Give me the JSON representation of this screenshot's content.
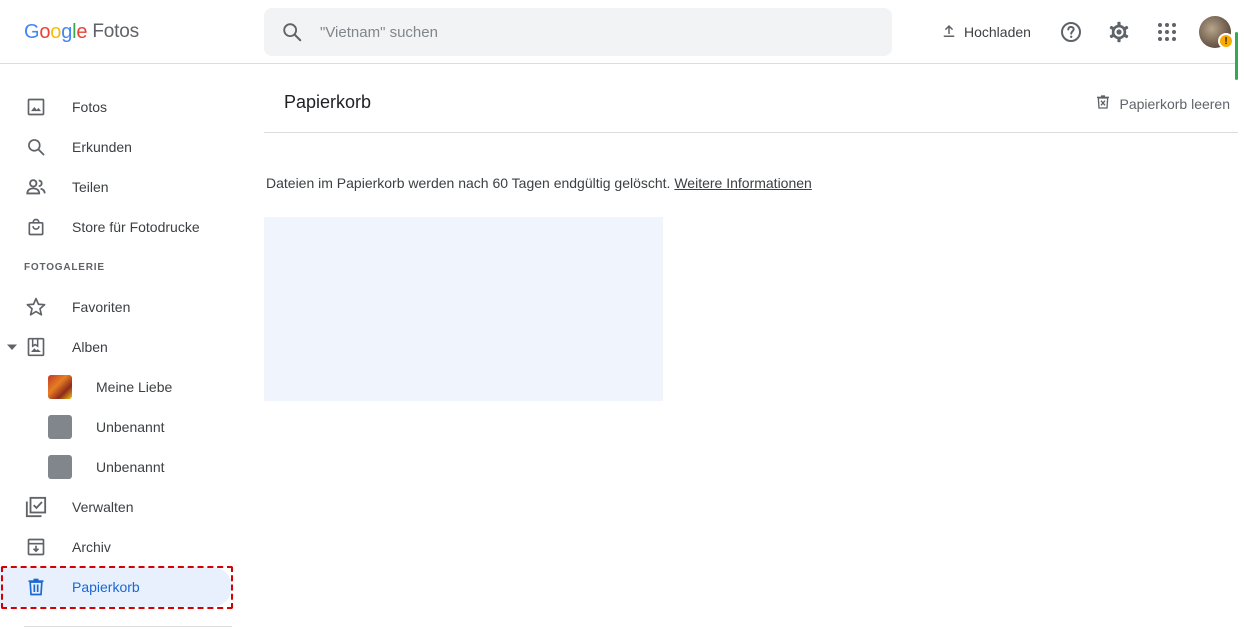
{
  "app": {
    "logo_letters": [
      "G",
      "o",
      "o",
      "g",
      "l",
      "e"
    ],
    "product": "Fotos"
  },
  "search": {
    "placeholder": "\"Vietnam\" suchen"
  },
  "header": {
    "upload_label": "Hochladen",
    "avatar_badge": "!"
  },
  "sidebar": {
    "items": [
      {
        "label": "Fotos",
        "icon": "photo-icon"
      },
      {
        "label": "Erkunden",
        "icon": "search-icon"
      },
      {
        "label": "Teilen",
        "icon": "people-icon"
      },
      {
        "label": "Store für Fotodrucke",
        "icon": "shopping-bag-icon"
      }
    ],
    "section_label": "FOTOGALERIE",
    "library": [
      {
        "label": "Favoriten",
        "icon": "star-icon"
      },
      {
        "label": "Alben",
        "icon": "album-icon"
      }
    ],
    "albums": [
      {
        "label": "Meine Liebe"
      },
      {
        "label": "Unbenannt"
      },
      {
        "label": "Unbenannt"
      }
    ],
    "more": [
      {
        "label": "Verwalten",
        "icon": "manage-icon"
      },
      {
        "label": "Archiv",
        "icon": "archive-icon"
      },
      {
        "label": "Papierkorb",
        "icon": "trash-icon",
        "active": true
      }
    ]
  },
  "main": {
    "title": "Papierkorb",
    "empty_trash_label": "Papierkorb leeren",
    "info_text": "Dateien im Papierkorb werden nach 60 Tagen endgültig gelöscht.",
    "info_link": "Weitere Informationen"
  },
  "colors": {
    "accent": "#1967d2",
    "active_bg": "#e8f0fe",
    "highlight_dash": "#d50000"
  }
}
